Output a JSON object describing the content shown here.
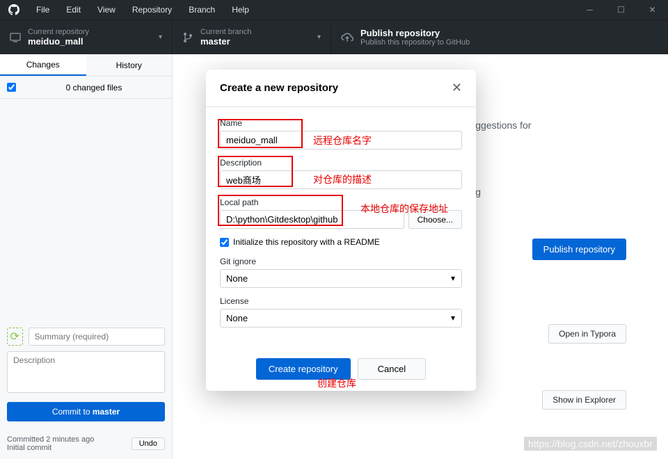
{
  "titlebar": {
    "menus": [
      "File",
      "Edit",
      "View",
      "Repository",
      "Branch",
      "Help"
    ]
  },
  "header": {
    "repo_label": "Current repository",
    "repo_name": "meiduo_mall",
    "branch_label": "Current branch",
    "branch_name": "master",
    "publish_label": "Publish repository",
    "publish_desc": "Publish this repository to GitHub"
  },
  "sidebar": {
    "tabs": {
      "changes": "Changes",
      "history": "History"
    },
    "changed_files": "0 changed files",
    "summary_placeholder": "Summary (required)",
    "description_placeholder": "Description",
    "commit_button_prefix": "Commit to ",
    "commit_button_branch": "master",
    "commit_time": "Committed 2 minutes ago",
    "commit_msg": "Initial commit",
    "undo": "Undo"
  },
  "content": {
    "suggestions": "iendly suggestions for",
    "publishing": "publishing",
    "publish_button": "Publish repository",
    "open_typora": "Open in Typora",
    "show_explorer": "Show in Explorer"
  },
  "modal": {
    "title": "Create a new repository",
    "name_label": "Name",
    "name_value": "meiduo_mall",
    "desc_label": "Description",
    "desc_value": "web商场",
    "path_label": "Local path",
    "path_value": "D:\\python\\Gitdesktop\\github",
    "choose": "Choose...",
    "readme_label": "Initialize this repository with a README",
    "gitignore_label": "Git ignore",
    "gitignore_value": "None",
    "license_label": "License",
    "license_value": "None",
    "create": "Create repository",
    "cancel": "Cancel"
  },
  "annotations": {
    "name": "远程仓库名字",
    "desc": "对仓库的描述",
    "path": "本地仓库的保存地址",
    "create": "创建仓库"
  },
  "watermark": "https://blog.csdn.net/zhouxbr"
}
